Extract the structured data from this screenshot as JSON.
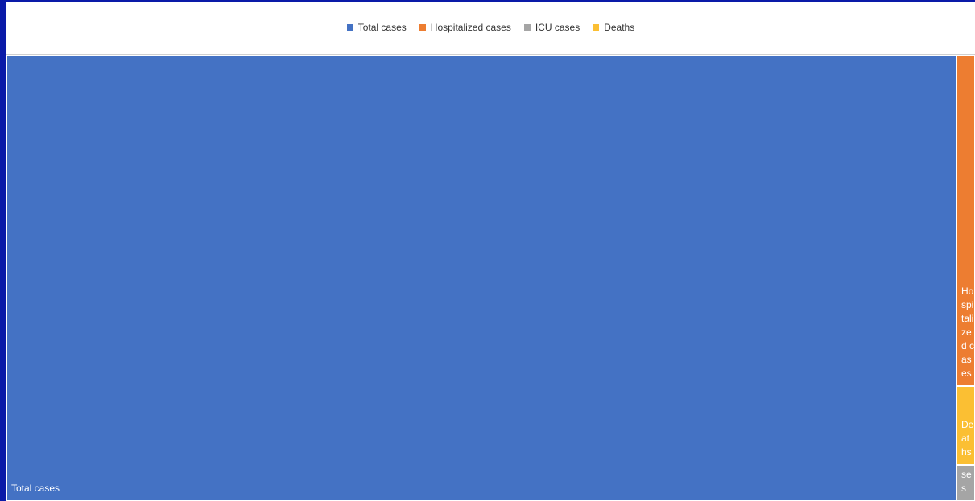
{
  "chart_data": {
    "type": "treemap",
    "title": "",
    "legend_position": "top",
    "categories": [
      "Total cases",
      "Hospitalized cases",
      "ICU cases",
      "Deaths"
    ],
    "values": [
      100,
      1.47,
      0.16,
      0.35
    ],
    "colors": {
      "Total cases": "#4472c4",
      "Hospitalized cases": "#ed7d31",
      "ICU cases": "#a5a5a5",
      "Deaths": "#fbbf33"
    },
    "tile_order": [
      "Total cases",
      "Hospitalized cases",
      "Deaths",
      "ICU cases"
    ],
    "tile_labels": {
      "Total cases": "Total cases",
      "Hospitalized cases": "Hospitalized cases",
      "Deaths": "Deaths",
      "ICU cases": "ICU cases"
    }
  }
}
